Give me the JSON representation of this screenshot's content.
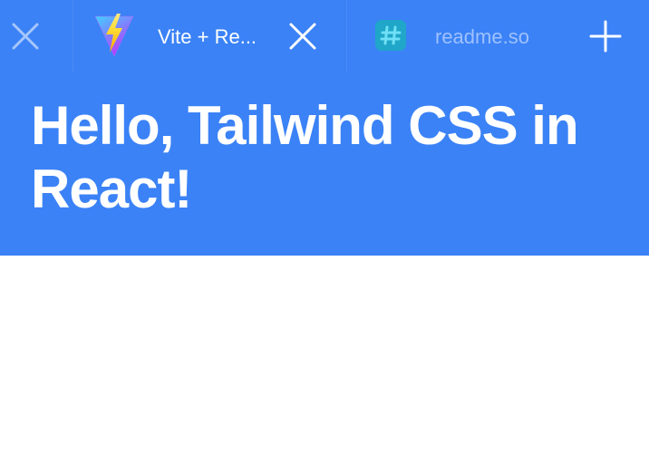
{
  "tabs": [
    {
      "title": "Vite + Re...",
      "icon": "vite-logo-icon",
      "active": true
    },
    {
      "title": "readme.so",
      "icon": "hash-icon",
      "active": false
    }
  ],
  "page": {
    "heading": "Hello, Tailwind CSS in React!"
  },
  "colors": {
    "page_background": "#3b82f6",
    "body_background": "#ffffff",
    "inactive_tab_text": "#9ec1ff",
    "readme_icon": "#1fa6c8"
  },
  "icons": [
    "close-icon",
    "vite-logo-icon",
    "hash-icon",
    "plus-icon"
  ]
}
